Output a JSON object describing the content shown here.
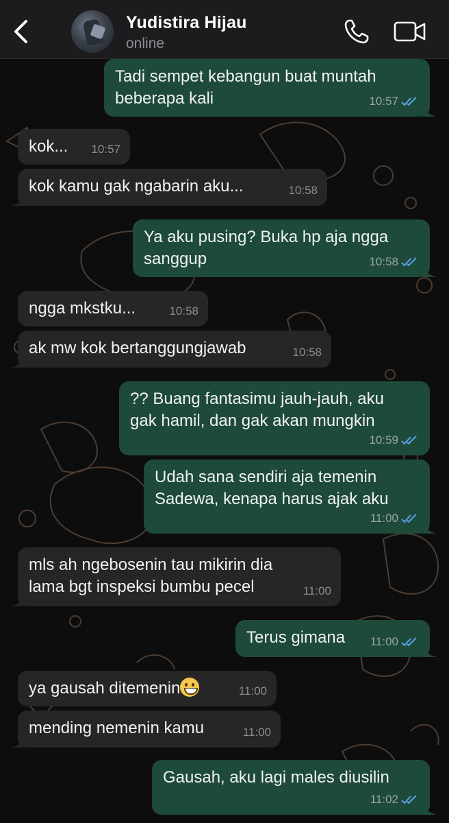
{
  "header": {
    "contact_name": "Yudistira Hijau",
    "status": "online"
  },
  "colors": {
    "header_bg": "#1c1c1e",
    "outgoing_bubble": "#1e4a3a",
    "incoming_bubble": "#262626",
    "read_tick": "#5aa0e8"
  },
  "messages": [
    {
      "dir": "out",
      "text": "Tadi sempet kebangun buat muntah\nbeberapa kali",
      "time": "10:57",
      "read": true
    },
    {
      "dir": "in",
      "text": "kok...",
      "time": "10:57"
    },
    {
      "dir": "in",
      "text": "kok kamu gak ngabarin aku...",
      "time": "10:58"
    },
    {
      "dir": "out",
      "text": "Ya aku pusing? Buka hp aja ngga\nsanggup",
      "time": "10:58",
      "read": true
    },
    {
      "dir": "in",
      "text": "ngga mkstku...",
      "time": "10:58"
    },
    {
      "dir": "in",
      "text": "ak mw kok bertanggungjawab",
      "time": "10:58"
    },
    {
      "dir": "out",
      "text": "?? Buang fantasimu jauh-jauh, aku\ngak hamil, dan gak akan mungkin",
      "time": "10:59",
      "read": true
    },
    {
      "dir": "out",
      "text": "Udah sana sendiri aja temenin\nSadewa, kenapa harus ajak aku",
      "time": "11:00",
      "read": true
    },
    {
      "dir": "in",
      "text": "mls ah ngebosenin tau mikirin dia\nlama bgt inspeksi bumbu pecel",
      "time": "11:00"
    },
    {
      "dir": "out",
      "text": "Terus gimana",
      "time": "11:00",
      "read": true
    },
    {
      "dir": "in",
      "text": "ya gausah ditemenin",
      "time": "11:00",
      "emoji": "grinning-face"
    },
    {
      "dir": "in",
      "text": "mending nemenin kamu",
      "time": "11:00"
    },
    {
      "dir": "out",
      "text": "Gausah, aku lagi males diusilin",
      "time": "11:02",
      "read": true
    }
  ]
}
